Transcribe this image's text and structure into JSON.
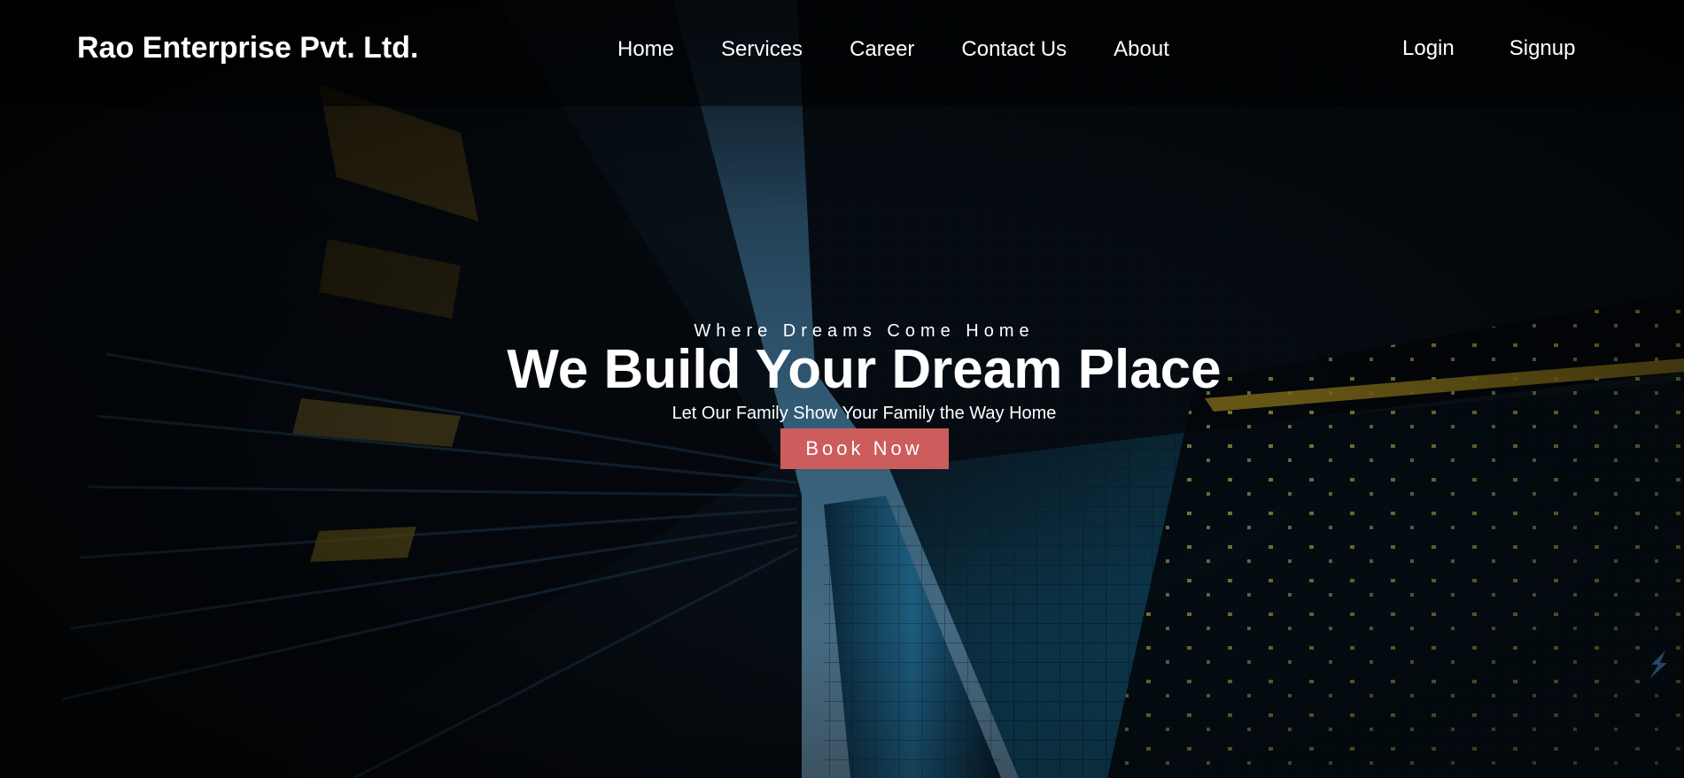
{
  "brand": {
    "name": "Rao Enterprise Pvt. Ltd."
  },
  "nav": {
    "links": [
      "Home",
      "Services",
      "Career",
      "Contact Us",
      "About"
    ]
  },
  "auth": {
    "login": "Login",
    "signup": "Signup"
  },
  "hero": {
    "tagline": "Where Dreams Come Home",
    "headline": "We Build Your Dream Place",
    "subline": "Let Our Family Show Your Family the Way Home",
    "cta_label": "Book Now",
    "background": "skyscrapers-looking-up-photo"
  },
  "colors": {
    "cta": "#cd5c5c",
    "text": "#ffffff",
    "sky": "#3a8bb8"
  },
  "icons": {
    "corner": "chevron-badge-icon"
  }
}
